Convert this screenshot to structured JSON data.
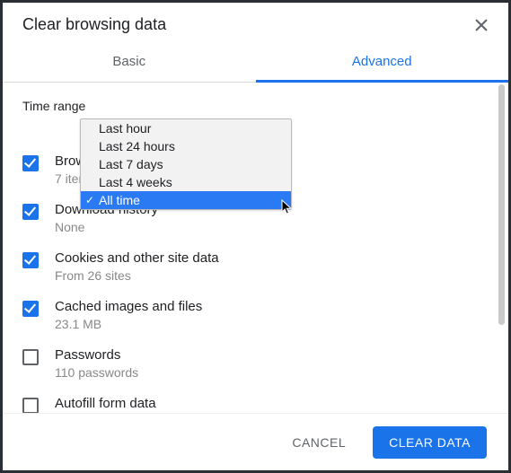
{
  "dialog": {
    "title": "Clear browsing data"
  },
  "tabs": {
    "basic": "Basic",
    "advanced": "Advanced",
    "active": "advanced"
  },
  "time": {
    "label": "Time range",
    "options": [
      "Last hour",
      "Last 24 hours",
      "Last 7 days",
      "Last 4 weeks",
      "All time"
    ],
    "selected_index": 4
  },
  "items": [
    {
      "checked": true,
      "label": "Browsing history",
      "sub": "7 items"
    },
    {
      "checked": true,
      "label": "Download history",
      "sub": "None"
    },
    {
      "checked": true,
      "label": "Cookies and other site data",
      "sub": "From 26 sites"
    },
    {
      "checked": true,
      "label": "Cached images and files",
      "sub": "23.1 MB"
    },
    {
      "checked": false,
      "label": "Passwords",
      "sub": "110 passwords"
    },
    {
      "checked": false,
      "label": "Autofill form data",
      "sub": ""
    }
  ],
  "footer": {
    "cancel": "CANCEL",
    "confirm": "CLEAR DATA"
  }
}
